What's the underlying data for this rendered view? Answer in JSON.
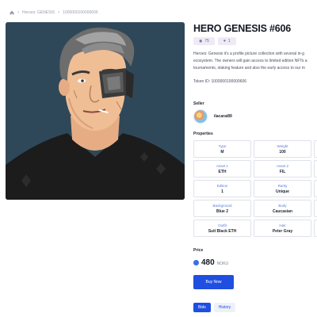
{
  "breadcrumb": {
    "home_icon": "home-icon",
    "items": [
      "Heroes: GENESIS",
      "1000000100000606"
    ]
  },
  "nft": {
    "title": "HERO GENESIS #606",
    "views": "75",
    "likes": "1",
    "description_lines": [
      "Heroes: Genesis it's a profile picture collection with several in-g",
      "ecosystem. The owners will gain access to limited edition NFTs a",
      "tournaments, staking feature and also the early access to our m"
    ],
    "token_id": "Token ID: 1000000100000606"
  },
  "seller": {
    "label": "Seller",
    "name": "ilacarai89"
  },
  "properties": {
    "label": "Properties",
    "items": [
      {
        "key": "Type",
        "value": "M"
      },
      {
        "key": "Weight",
        "value": "100"
      },
      {
        "key": "Asset 1",
        "value": "ETH"
      },
      {
        "key": "Asset 2",
        "value": "FIL"
      },
      {
        "key": "Edition",
        "value": "1"
      },
      {
        "key": "Rarity",
        "value": "Unique"
      },
      {
        "key": "Background",
        "value": "Blue 2"
      },
      {
        "key": "Body",
        "value": "Caucasian"
      },
      {
        "key": "Outfit",
        "value": "Suit Black ETH"
      },
      {
        "key": "Hair",
        "value": "Peter Gray"
      }
    ]
  },
  "price": {
    "label": "Price",
    "value": "480",
    "unit": "NOKU"
  },
  "actions": {
    "buy_label": "Buy Now"
  },
  "tabs": [
    "Bids",
    "History"
  ],
  "colors": {
    "accent": "#1f4fe0",
    "art_background": "#2f4859"
  }
}
